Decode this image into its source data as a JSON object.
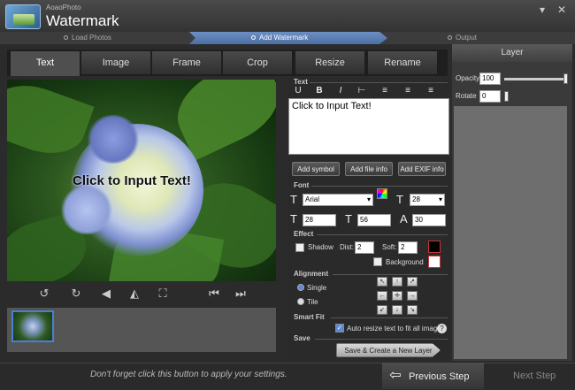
{
  "app": {
    "brand_small": "AoaoPhoto",
    "brand_big": "Watermark",
    "min": "▾",
    "close": "✕"
  },
  "steps": [
    {
      "label": "Load Photos"
    },
    {
      "label": "Add Watermark"
    },
    {
      "label": "Output"
    }
  ],
  "tabs": [
    {
      "label": "Text"
    },
    {
      "label": "Image"
    },
    {
      "label": "Frame"
    },
    {
      "label": "Crop"
    },
    {
      "label": "Resize"
    },
    {
      "label": "Rename"
    }
  ],
  "preview": {
    "watermark_text": "Click to Input Text!"
  },
  "text_section": {
    "header": "Text",
    "format_icons": [
      "U",
      "B",
      "I",
      "⊢",
      "≡",
      "≡",
      "≡"
    ],
    "input_value": "Click to Input Text!",
    "add_symbol": "Add symbol",
    "add_file_info": "Add file info",
    "add_exif_info": "Add EXIF info"
  },
  "font_section": {
    "header": "Font",
    "font_name": "Arial",
    "size": "28",
    "width": "28",
    "spacing": "56",
    "line_spacing": "30"
  },
  "effect_section": {
    "header": "Effect",
    "shadow": "Shadow",
    "dist_label": "Dist:",
    "dist": "2",
    "soft_label": "Soft:",
    "soft": "2",
    "background": "Background"
  },
  "alignment_section": {
    "header": "Alignment",
    "single": "Single",
    "tile": "Tile"
  },
  "smart_fit": {
    "header": "Smart Fit",
    "auto_resize": "Auto resize text to fit all images",
    "help": "?"
  },
  "save_section": {
    "header": "Save",
    "save_button": "Save & Create a New Layer"
  },
  "layer_panel": {
    "title": "Layer",
    "opacity_label": "Opacity",
    "opacity": "100",
    "opacity_level": 1.0,
    "rotate_label": "Rotate",
    "rotate": "0",
    "rotate_level": 0.0
  },
  "bottom": {
    "hint": "Don't forget click this button to apply your settings.",
    "previous": "Previous Step",
    "next": "Next Step"
  }
}
